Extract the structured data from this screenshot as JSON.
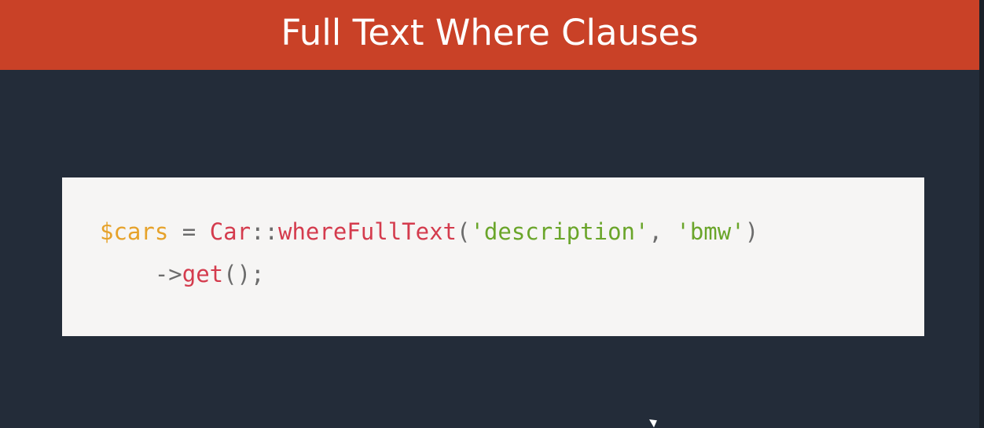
{
  "slide": {
    "title": "Full Text Where Clauses"
  },
  "code": {
    "line1": {
      "var": "$cars",
      "assign": " = ",
      "class": "Car",
      "scope": "::",
      "method": "whereFullText",
      "open": "(",
      "arg1": "'description'",
      "comma": ", ",
      "arg2": "'bmw'",
      "close": ")"
    },
    "line2": {
      "indent": "    ",
      "arrow": "->",
      "method": "get",
      "call": "();"
    }
  },
  "colors": {
    "title_bar": "#c94127",
    "background": "#232c39",
    "code_background": "#f6f5f4",
    "variable": "#e6a22a",
    "class": "#d43b4d",
    "string": "#6aa52a"
  },
  "icons": {
    "cursor": "mouse-pointer-icon"
  }
}
